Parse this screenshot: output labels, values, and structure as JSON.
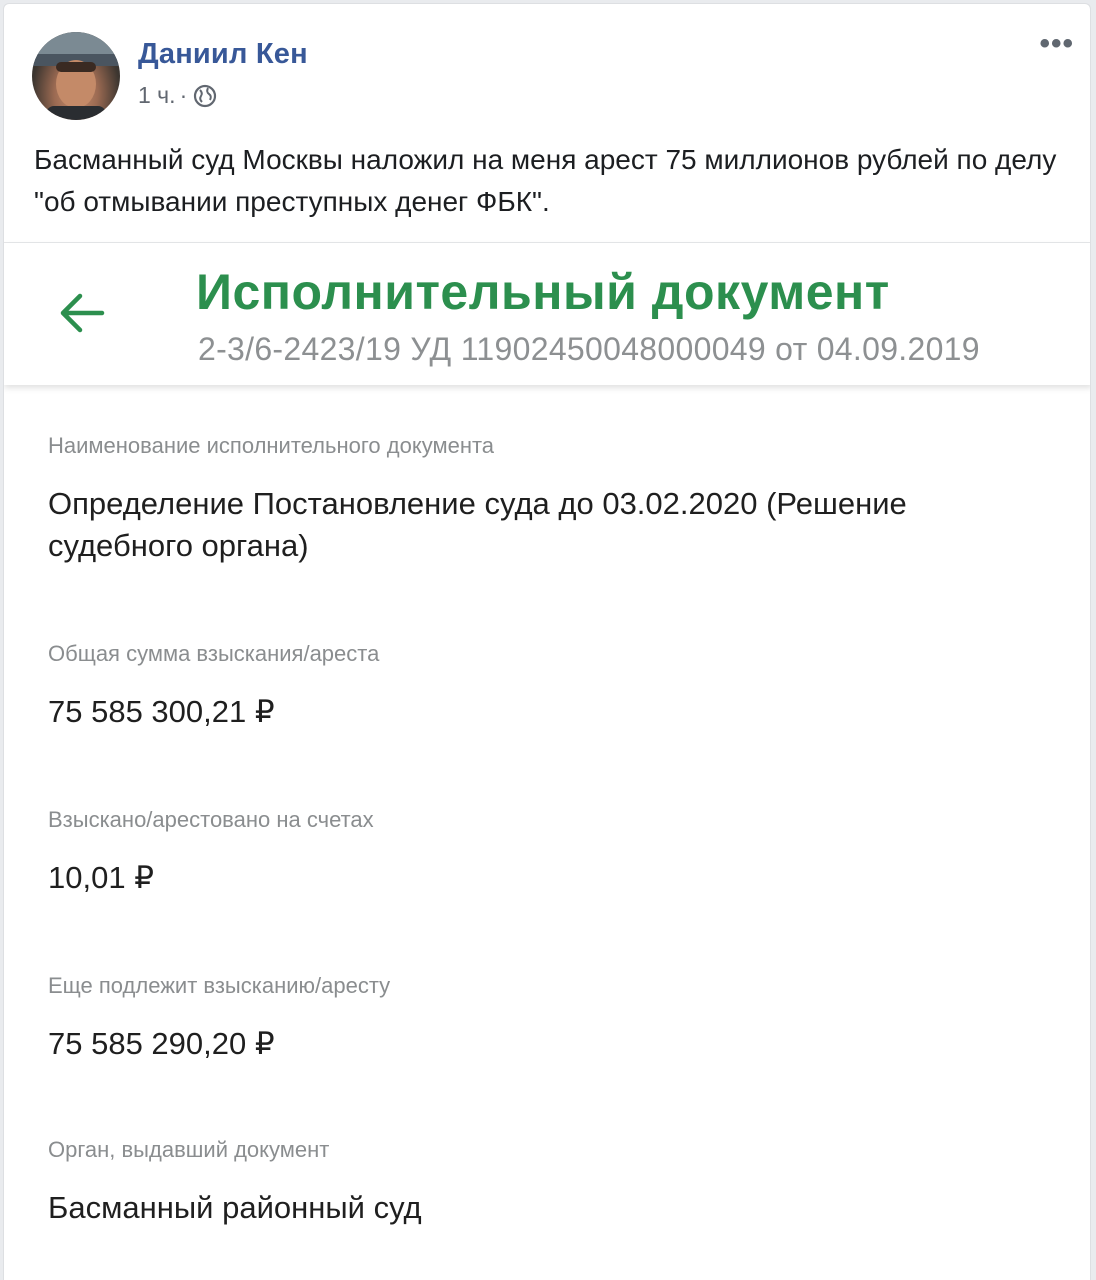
{
  "post": {
    "author": "Даниил Кен",
    "time": "1 ч.",
    "separator": "·",
    "visibility_icon": "globe-icon",
    "more_label": "•••",
    "text": "Басманный суд Москвы наложил на меня арест 75 миллионов рублей по делу \"об отмывании преступных денег ФБК\"."
  },
  "document": {
    "back_icon": "arrow-left-icon",
    "title": "Исполнительный документ",
    "subtitle": "2-3/6-2423/19 УД 11902450048000049 от 04.09.2019",
    "accent_color": "#2c8f4e",
    "fields": [
      {
        "label": "Наименование исполнительного документа",
        "value": "Определение Постановление суда до 03.02.2020 (Решение судебного органа)"
      },
      {
        "label": "Общая сумма взыскания/ареста",
        "value": "75 585 300,21 ₽"
      },
      {
        "label": "Взыскано/арестовано на счетах",
        "value": "10,01 ₽"
      },
      {
        "label": "Еще подлежит взысканию/аресту",
        "value": "75 585 290,20 ₽"
      },
      {
        "label": "Орган, выдавший документ",
        "value": "Басманный районный суд"
      }
    ]
  }
}
